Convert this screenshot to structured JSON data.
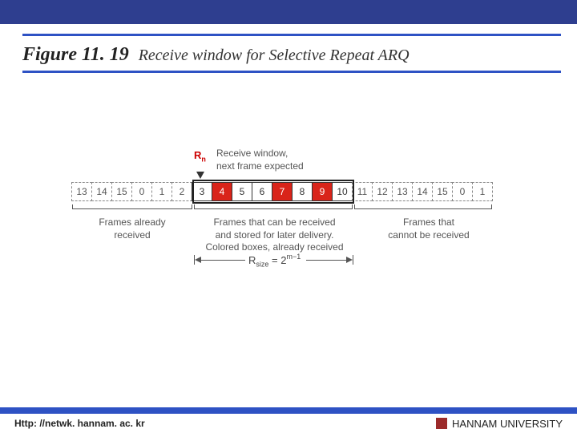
{
  "figure": {
    "num": "Figure 11. 19",
    "title": "Receive window for Selective Repeat ARQ"
  },
  "rn": "R",
  "rn_sub": "n",
  "rwin_lbl": "Receive window,\nnext frame expected",
  "left_lbl": "Frames already\nreceived",
  "mid_lbl": "Frames that can be received\nand stored for later delivery.\nColored boxes, already received",
  "right_lbl": "Frames that\ncannot be received",
  "rsize": "R",
  "rsize_sub": "size",
  "rsize_eq": " = 2",
  "rsize_exp": "m−1",
  "cells": [
    {
      "v": "13",
      "t": "dashed"
    },
    {
      "v": "14",
      "t": "dashed"
    },
    {
      "v": "15",
      "t": "dashed"
    },
    {
      "v": "0",
      "t": "dashed"
    },
    {
      "v": "1",
      "t": "dashed"
    },
    {
      "v": "2",
      "t": "dashed"
    },
    {
      "v": "3",
      "t": "win"
    },
    {
      "v": "4",
      "t": "recv"
    },
    {
      "v": "5",
      "t": "win"
    },
    {
      "v": "6",
      "t": "win"
    },
    {
      "v": "7",
      "t": "recv"
    },
    {
      "v": "8",
      "t": "win"
    },
    {
      "v": "9",
      "t": "recv"
    },
    {
      "v": "10",
      "t": "win"
    },
    {
      "v": "11",
      "t": "dashed"
    },
    {
      "v": "12",
      "t": "dashed"
    },
    {
      "v": "13",
      "t": "dashed"
    },
    {
      "v": "14",
      "t": "dashed"
    },
    {
      "v": "15",
      "t": "dashed"
    },
    {
      "v": "0",
      "t": "dashed"
    },
    {
      "v": "1",
      "t": "dashed"
    }
  ],
  "footer": {
    "url": "Http: //netwk. hannam. ac. kr",
    "uni": "HANNAM  UNIVERSITY"
  }
}
